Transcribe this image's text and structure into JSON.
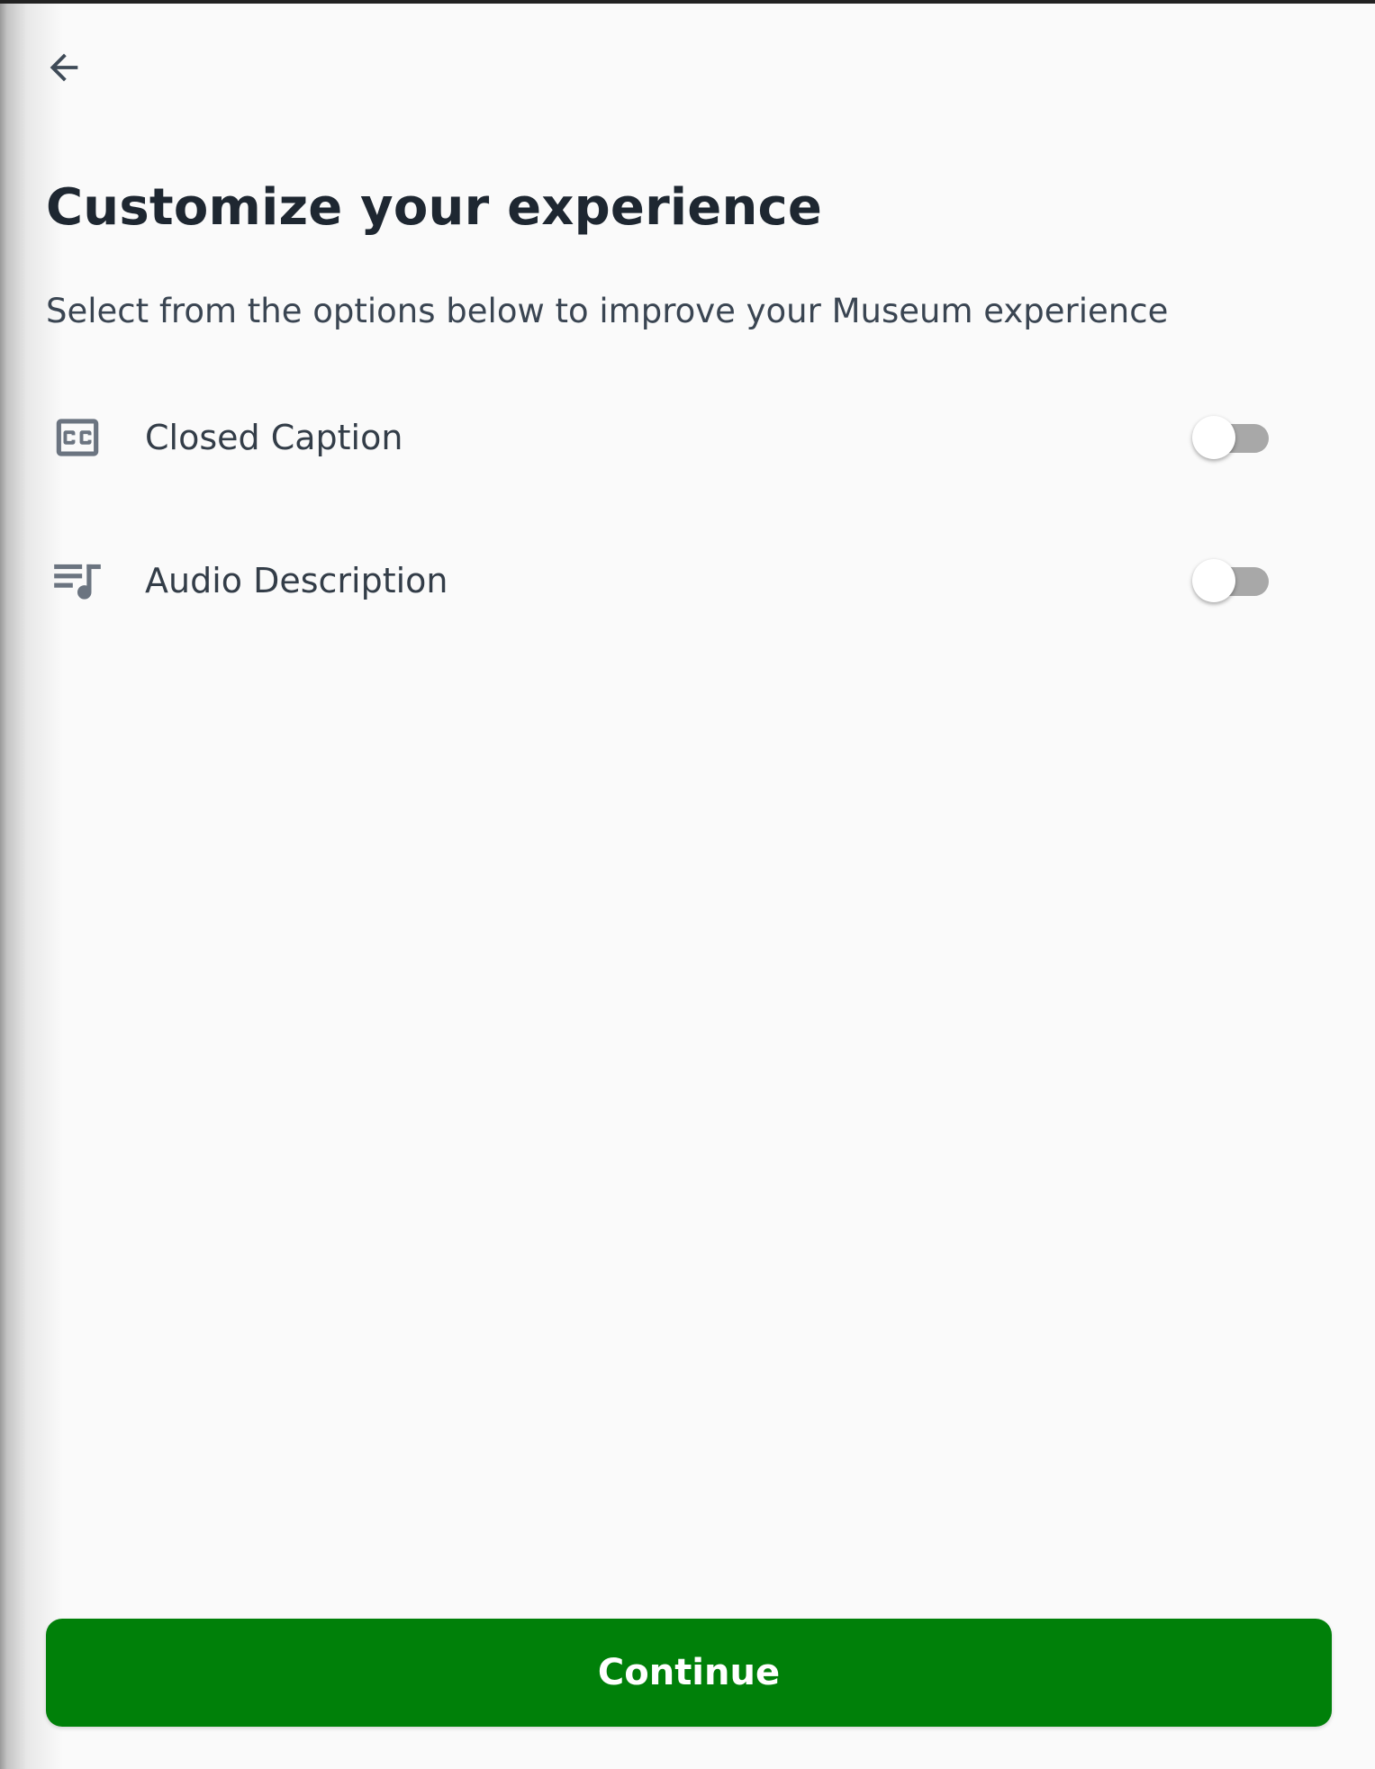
{
  "header": {
    "back_icon": "arrow-left-icon"
  },
  "page": {
    "title": "Customize your experience",
    "subtitle": "Select from the options below to improve your Museum experience"
  },
  "options": [
    {
      "icon": "closed-caption-icon",
      "label": "Closed Caption",
      "enabled": false
    },
    {
      "icon": "audio-description-icon",
      "label": "Audio Description",
      "enabled": false
    }
  ],
  "footer": {
    "continue_label": "Continue"
  },
  "colors": {
    "background": "#fafafa",
    "title": "#1e2731",
    "text": "#333d48",
    "icon": "#6b7480",
    "toggle_track_off": "#a8a8a8",
    "toggle_thumb": "#ffffff",
    "primary": "#008009",
    "primary_text": "#ffffff"
  }
}
